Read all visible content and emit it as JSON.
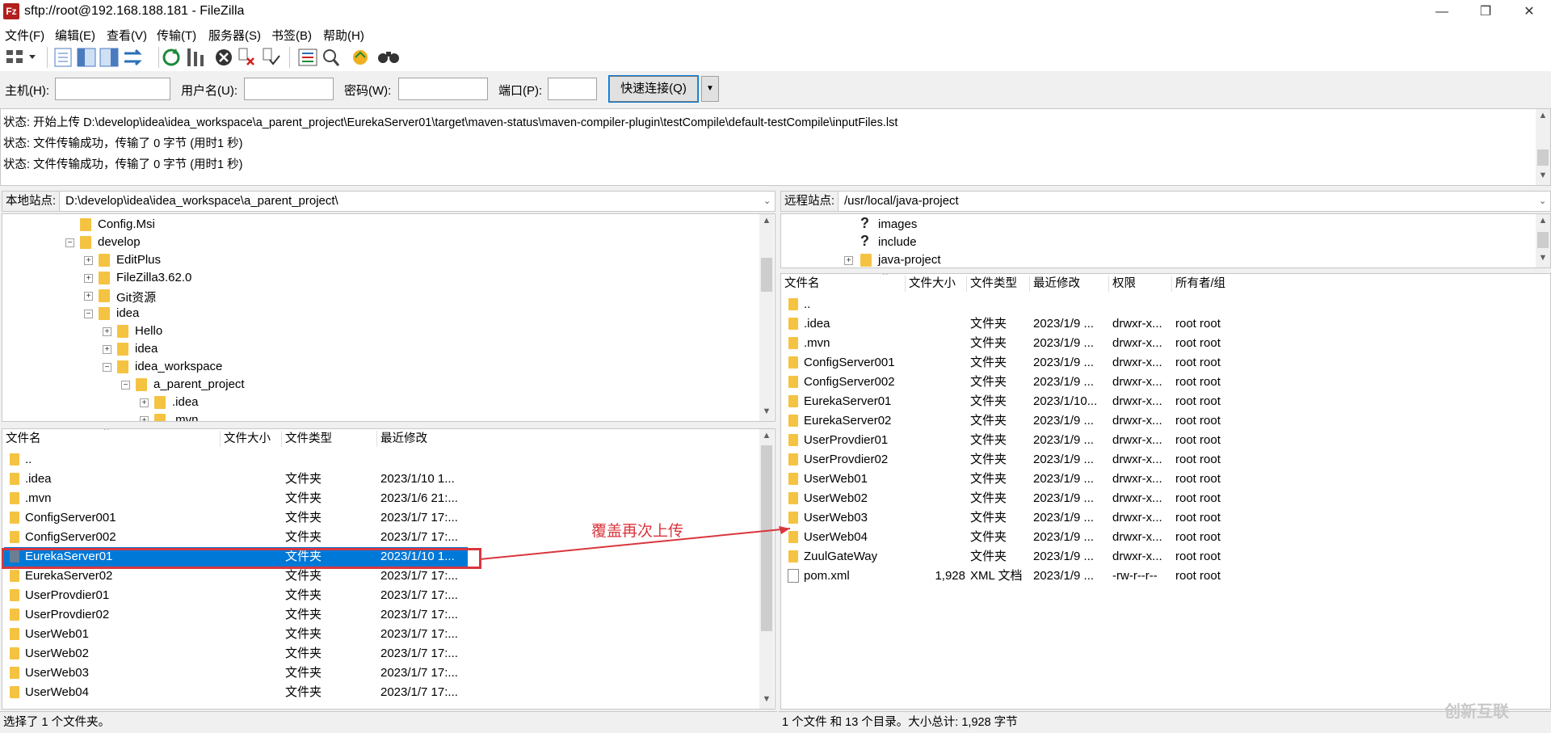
{
  "window": {
    "title": "sftp://root@192.168.188.181 - FileZilla",
    "app_icon_text": "Fz"
  },
  "menu": [
    "文件(F)",
    "编辑(E)",
    "查看(V)",
    "传输(T)",
    "服务器(S)",
    "书签(B)",
    "帮助(H)"
  ],
  "quickconnect": {
    "host_label": "主机(H):",
    "user_label": "用户名(U):",
    "pass_label": "密码(W):",
    "port_label": "端口(P):",
    "host_value": "",
    "user_value": "",
    "pass_value": "",
    "port_value": "",
    "connect_label": "快速连接(Q)"
  },
  "log": [
    "状态:  开始上传 D:\\develop\\idea\\idea_workspace\\a_parent_project\\EurekaServer01\\target\\maven-status\\maven-compiler-plugin\\testCompile\\default-testCompile\\inputFiles.lst",
    "状态:  文件传输成功，传输了 0 字节 (用时1 秒)",
    "状态:  文件传输成功，传输了 0 字节 (用时1 秒)"
  ],
  "local": {
    "site_label": "本地站点:",
    "path": "D:\\develop\\idea\\idea_workspace\\a_parent_project\\",
    "tree": [
      {
        "label": "Config.Msi",
        "level": 0,
        "exp": ""
      },
      {
        "label": "develop",
        "level": 0,
        "exp": "−"
      },
      {
        "label": "EditPlus",
        "level": 1,
        "exp": "+"
      },
      {
        "label": "FileZilla3.62.0",
        "level": 1,
        "exp": "+"
      },
      {
        "label": "Git资源",
        "level": 1,
        "exp": "+"
      },
      {
        "label": "idea",
        "level": 1,
        "exp": "−"
      },
      {
        "label": "Hello",
        "level": 2,
        "exp": "+"
      },
      {
        "label": "idea",
        "level": 2,
        "exp": "+"
      },
      {
        "label": "idea_workspace",
        "level": 2,
        "exp": "−"
      },
      {
        "label": "a_parent_project",
        "level": 3,
        "exp": "−"
      },
      {
        "label": ".idea",
        "level": 4,
        "exp": "+"
      },
      {
        "label": ".mvn",
        "level": 4,
        "exp": "+"
      }
    ],
    "columns": [
      "文件名",
      "文件大小",
      "文件类型",
      "最近修改"
    ],
    "files": [
      {
        "name": "..",
        "size": "",
        "type": "",
        "modified": ""
      },
      {
        "name": ".idea",
        "size": "",
        "type": "文件夹",
        "modified": "2023/1/10 1..."
      },
      {
        "name": ".mvn",
        "size": "",
        "type": "文件夹",
        "modified": "2023/1/6 21:..."
      },
      {
        "name": "ConfigServer001",
        "size": "",
        "type": "文件夹",
        "modified": "2023/1/7 17:..."
      },
      {
        "name": "ConfigServer002",
        "size": "",
        "type": "文件夹",
        "modified": "2023/1/7 17:..."
      },
      {
        "name": "EurekaServer01",
        "size": "",
        "type": "文件夹",
        "modified": "2023/1/10 1..."
      },
      {
        "name": "EurekaServer02",
        "size": "",
        "type": "文件夹",
        "modified": "2023/1/7 17:..."
      },
      {
        "name": "UserProvdier01",
        "size": "",
        "type": "文件夹",
        "modified": "2023/1/7 17:..."
      },
      {
        "name": "UserProvdier02",
        "size": "",
        "type": "文件夹",
        "modified": "2023/1/7 17:..."
      },
      {
        "name": "UserWeb01",
        "size": "",
        "type": "文件夹",
        "modified": "2023/1/7 17:..."
      },
      {
        "name": "UserWeb02",
        "size": "",
        "type": "文件夹",
        "modified": "2023/1/7 17:..."
      },
      {
        "name": "UserWeb03",
        "size": "",
        "type": "文件夹",
        "modified": "2023/1/7 17:..."
      },
      {
        "name": "UserWeb04",
        "size": "",
        "type": "文件夹",
        "modified": "2023/1/7 17:..."
      }
    ],
    "selected_index": 5,
    "status": "选择了 1 个文件夹。"
  },
  "remote": {
    "site_label": "远程站点:",
    "path": "/usr/local/java-project",
    "tree": [
      {
        "label": "images",
        "level": 0,
        "icon": "question-icon"
      },
      {
        "label": "include",
        "level": 0,
        "icon": "question-icon"
      },
      {
        "label": "java-project",
        "level": 0,
        "icon": "folder-icon"
      }
    ],
    "columns": [
      "文件名",
      "文件大小",
      "文件类型",
      "最近修改",
      "权限",
      "所有者/组"
    ],
    "files": [
      {
        "name": "..",
        "size": "",
        "type": "",
        "modified": "",
        "perm": "",
        "owner": ""
      },
      {
        "name": ".idea",
        "size": "",
        "type": "文件夹",
        "modified": "2023/1/9 ...",
        "perm": "drwxr-x...",
        "owner": "root root"
      },
      {
        "name": ".mvn",
        "size": "",
        "type": "文件夹",
        "modified": "2023/1/9 ...",
        "perm": "drwxr-x...",
        "owner": "root root"
      },
      {
        "name": "ConfigServer001",
        "size": "",
        "type": "文件夹",
        "modified": "2023/1/9 ...",
        "perm": "drwxr-x...",
        "owner": "root root"
      },
      {
        "name": "ConfigServer002",
        "size": "",
        "type": "文件夹",
        "modified": "2023/1/9 ...",
        "perm": "drwxr-x...",
        "owner": "root root"
      },
      {
        "name": "EurekaServer01",
        "size": "",
        "type": "文件夹",
        "modified": "2023/1/10...",
        "perm": "drwxr-x...",
        "owner": "root root"
      },
      {
        "name": "EurekaServer02",
        "size": "",
        "type": "文件夹",
        "modified": "2023/1/9 ...",
        "perm": "drwxr-x...",
        "owner": "root root"
      },
      {
        "name": "UserProvdier01",
        "size": "",
        "type": "文件夹",
        "modified": "2023/1/9 ...",
        "perm": "drwxr-x...",
        "owner": "root root"
      },
      {
        "name": "UserProvdier02",
        "size": "",
        "type": "文件夹",
        "modified": "2023/1/9 ...",
        "perm": "drwxr-x...",
        "owner": "root root"
      },
      {
        "name": "UserWeb01",
        "size": "",
        "type": "文件夹",
        "modified": "2023/1/9 ...",
        "perm": "drwxr-x...",
        "owner": "root root"
      },
      {
        "name": "UserWeb02",
        "size": "",
        "type": "文件夹",
        "modified": "2023/1/9 ...",
        "perm": "drwxr-x...",
        "owner": "root root"
      },
      {
        "name": "UserWeb03",
        "size": "",
        "type": "文件夹",
        "modified": "2023/1/9 ...",
        "perm": "drwxr-x...",
        "owner": "root root"
      },
      {
        "name": "UserWeb04",
        "size": "",
        "type": "文件夹",
        "modified": "2023/1/9 ...",
        "perm": "drwxr-x...",
        "owner": "root root"
      },
      {
        "name": "ZuulGateWay",
        "size": "",
        "type": "文件夹",
        "modified": "2023/1/9 ...",
        "perm": "drwxr-x...",
        "owner": "root root"
      },
      {
        "name": "pom.xml",
        "size": "1,928",
        "type": "XML 文档",
        "modified": "2023/1/9 ...",
        "perm": "-rw-r--r--",
        "owner": "root root",
        "is_file": true
      }
    ],
    "status": "1 个文件 和 13 个目录。大小总计: 1,928 字节"
  },
  "annotation": {
    "text": "覆盖再次上传",
    "color": "#d9363e"
  },
  "watermark": "创新互联",
  "colors": {
    "selection": "#0078d7",
    "folder": "#f5c342",
    "accent": "#0078d7"
  }
}
